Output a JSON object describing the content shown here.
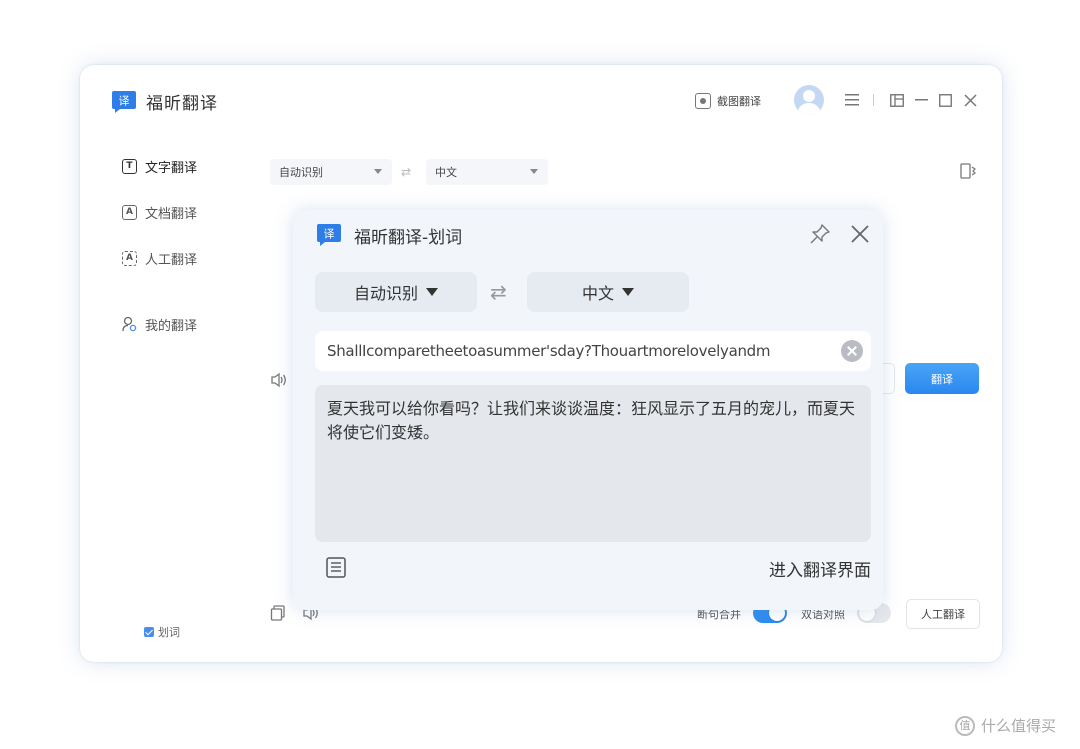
{
  "app": {
    "name": "福昕翻译",
    "logo_glyph": "译"
  },
  "header": {
    "screenshot_translate": "截图翻译"
  },
  "sidebar": {
    "items": [
      {
        "label": "文字翻译",
        "icon_glyph": "T"
      },
      {
        "label": "文档翻译",
        "icon_glyph": "A"
      },
      {
        "label": "人工翻译",
        "icon_glyph": "A"
      },
      {
        "label": "我的翻译"
      }
    ],
    "huaci_label": "划词"
  },
  "main": {
    "source_lang": "自动识别",
    "target_lang": "中文",
    "translate_button": "翻译",
    "sentence_merge_label": "断句合并",
    "bilingual_label": "双语对照",
    "human_translate_button": "人工翻译",
    "sentence_merge_on": true,
    "bilingual_on": false
  },
  "popup": {
    "title": "福昕翻译-划词",
    "source_lang": "自动识别",
    "target_lang": "中文",
    "input_text": "ShallIcomparetheetoasummer'sday?Thouartmorelovelyandm",
    "output_text": "夏天我可以给你看吗？让我们来谈谈温度：狂风显示了五月的宠儿，而夏天将使它们变矮。",
    "enter_link": "进入翻译界面"
  },
  "watermark": {
    "text": "什么值得买",
    "icon_glyph": "值"
  },
  "colors": {
    "accent": "#2c8cf0",
    "logo_blue": "#2f7de6"
  }
}
